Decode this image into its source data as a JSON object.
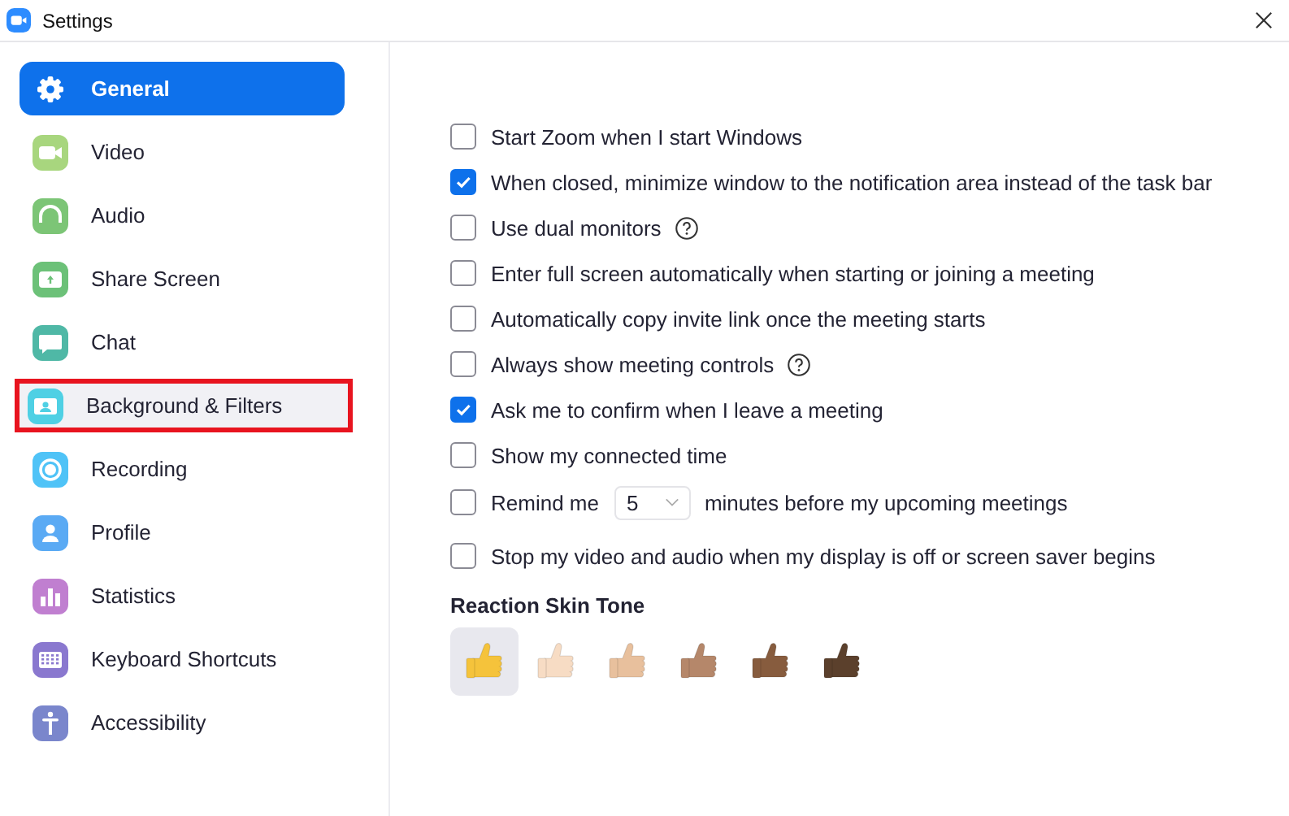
{
  "window": {
    "title": "Settings"
  },
  "sidebar": {
    "items": [
      {
        "label": "General",
        "selected": true,
        "outlined": false,
        "color": "#ffffff"
      },
      {
        "label": "Video",
        "selected": false,
        "outlined": false,
        "color": "#a8d67e"
      },
      {
        "label": "Audio",
        "selected": false,
        "outlined": false,
        "color": "#7cc576"
      },
      {
        "label": "Share Screen",
        "selected": false,
        "outlined": false,
        "color": "#6cc178"
      },
      {
        "label": "Chat",
        "selected": false,
        "outlined": false,
        "color": "#4fb8a6"
      },
      {
        "label": "Background & Filters",
        "selected": false,
        "outlined": true,
        "color": "#4fd0e4"
      },
      {
        "label": "Recording",
        "selected": false,
        "outlined": false,
        "color": "#4fc3f7"
      },
      {
        "label": "Profile",
        "selected": false,
        "outlined": false,
        "color": "#5aaaf4"
      },
      {
        "label": "Statistics",
        "selected": false,
        "outlined": false,
        "color": "#c07fd0"
      },
      {
        "label": "Keyboard Shortcuts",
        "selected": false,
        "outlined": false,
        "color": "#8a78cf"
      },
      {
        "label": "Accessibility",
        "selected": false,
        "outlined": false,
        "color": "#7a86cc"
      }
    ]
  },
  "options": [
    {
      "kind": "checkbox",
      "label": "Start Zoom when I start Windows",
      "checked": false,
      "help": false
    },
    {
      "kind": "checkbox",
      "label": "When closed, minimize window to the notification area instead of the task bar",
      "checked": true,
      "help": false
    },
    {
      "kind": "checkbox",
      "label": "Use dual monitors",
      "checked": false,
      "help": true
    },
    {
      "kind": "checkbox",
      "label": "Enter full screen automatically when starting or joining a meeting",
      "checked": false,
      "help": false
    },
    {
      "kind": "checkbox",
      "label": "Automatically copy invite link once the meeting starts",
      "checked": false,
      "help": false
    },
    {
      "kind": "checkbox",
      "label": "Always show meeting controls",
      "checked": false,
      "help": true
    },
    {
      "kind": "checkbox",
      "label": "Ask me to confirm when I leave a meeting",
      "checked": true,
      "help": false
    },
    {
      "kind": "checkbox",
      "label": "Show my connected time",
      "checked": false,
      "help": false
    },
    {
      "kind": "dropdown",
      "label": "Remind me",
      "value": "5",
      "label_after": "minutes before my upcoming meetings",
      "checked": false
    },
    {
      "kind": "checkbox",
      "label": "Stop my video and audio when my display is off or screen saver begins",
      "checked": false,
      "help": false
    }
  ],
  "skin_tone": {
    "heading": "Reaction Skin Tone",
    "tones": [
      {
        "color": "#f5c33b",
        "selected": true
      },
      {
        "color": "#f7dcc4",
        "selected": false
      },
      {
        "color": "#e8c09d",
        "selected": false
      },
      {
        "color": "#b5876a",
        "selected": false
      },
      {
        "color": "#875c3e",
        "selected": false
      },
      {
        "color": "#5b402c",
        "selected": false
      }
    ]
  }
}
